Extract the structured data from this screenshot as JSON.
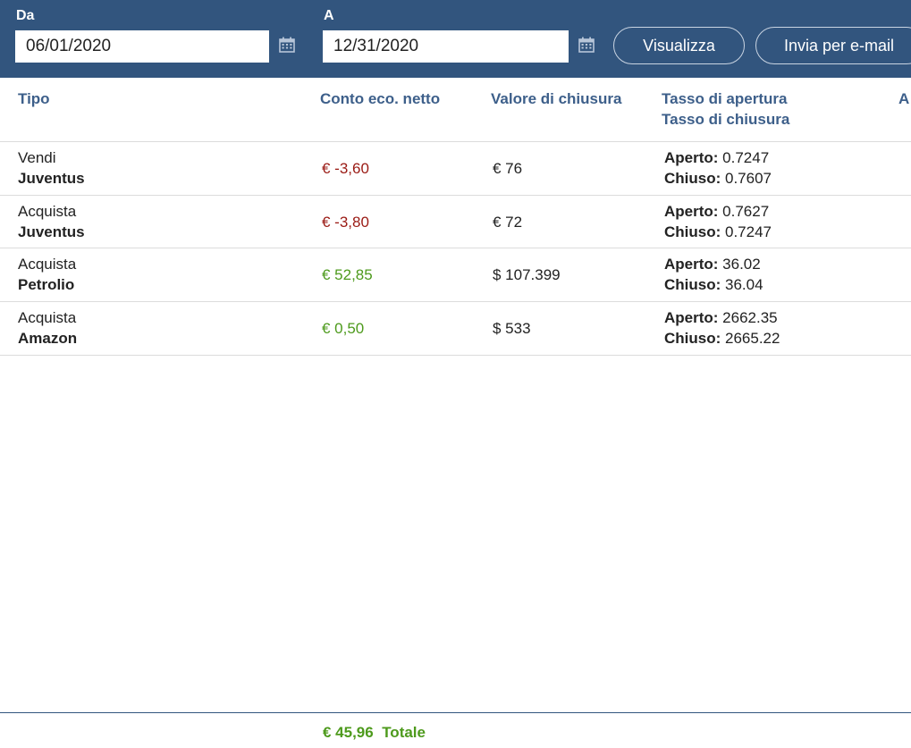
{
  "filters": {
    "from_label": "Da",
    "from_value": "06/01/2020",
    "to_label": "A",
    "to_value": "12/31/2020",
    "view_button": "Visualizza",
    "email_button": "Invia per e-mail"
  },
  "columns": {
    "type": "Tipo",
    "net_pl": "Conto eco. netto",
    "close_value": "Valore di chiusura",
    "rates_line1": "Tasso di apertura",
    "rates_line2": "Tasso di chiusura",
    "next_partial": "A"
  },
  "rate_labels": {
    "open": "Aperto:",
    "close": "Chiuso:"
  },
  "rows": [
    {
      "action": "Vendi",
      "instrument": "Juventus",
      "net_pl": "€ -3,60",
      "close_value": "€ 76",
      "open_rate": " 0.7247",
      "close_rate": " 0.7607"
    },
    {
      "action": "Acquista",
      "instrument": "Juventus",
      "net_pl": "€ -3,80",
      "close_value": "€ 72",
      "open_rate": " 0.7627",
      "close_rate": " 0.7247"
    },
    {
      "action": "Acquista",
      "instrument": "Petrolio",
      "net_pl": "€ 52,85",
      "close_value": "$ 107.399",
      "open_rate": " 36.02",
      "close_rate": " 36.04"
    },
    {
      "action": "Acquista",
      "instrument": "Amazon",
      "net_pl": "€ 0,50",
      "close_value": "$ 533",
      "open_rate": " 2662.35",
      "close_rate": " 2665.22"
    }
  ],
  "footer": {
    "total_value": "€ 45,96",
    "total_label": "Totale"
  },
  "colors": {
    "header_bg": "#32557e",
    "column_header": "#3d5f8a",
    "negative": "#9a1a14",
    "positive": "#4d9a1c"
  },
  "icons": {
    "calendar": "calendar-icon"
  }
}
